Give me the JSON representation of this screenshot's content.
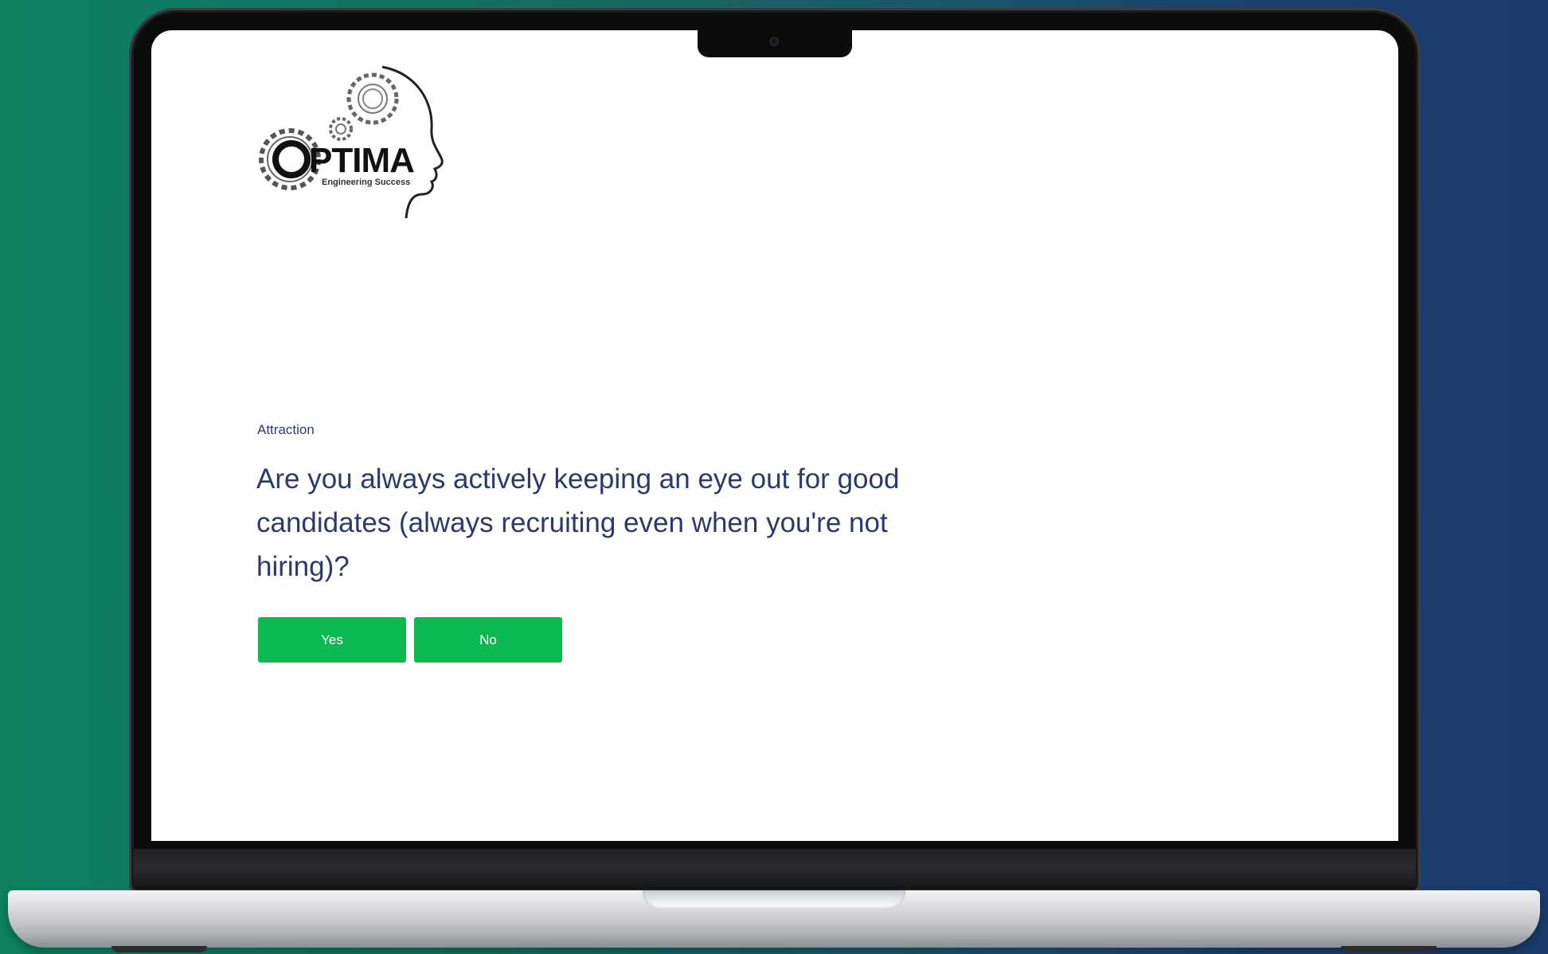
{
  "theme": {
    "button_color": "#0cb852",
    "text_color": "#2c3a6b"
  },
  "logo": {
    "wordmark": "OPTIMA",
    "tagline": "Engineering Success"
  },
  "quiz": {
    "category": "Attraction",
    "question": "Are you always actively keeping an eye out for good candidates (always recruiting even when you're not hiring)?",
    "answers": {
      "yes_label": "Yes",
      "no_label": "No"
    }
  }
}
